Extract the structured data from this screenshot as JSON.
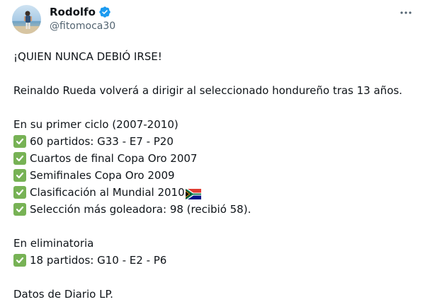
{
  "tweet": {
    "author_name": "Rodolfo",
    "author_handle": "@fitomoca30",
    "avatar_icon": "profile-photo-beach",
    "verified_icon": "verified-badge-icon",
    "more_icon": "more-options-icon",
    "lines": {
      "l1": "¡QUIEN NUNCA DEBIÓ IRSE!",
      "l2": "Reinaldo Rueda volverá a dirigir al seleccionado hondureño tras 13 años.",
      "l3": "En su primer ciclo (2007-2010)",
      "l4": "60 partidos: G33 - E7 - P20",
      "l5": "Cuartos de final Copa Oro 2007",
      "l6": "Semifinales Copa Oro 2009",
      "l7": "Clasificación al Mundial 2010",
      "l8": "Selección más goleadora: 98 (recibió 58).",
      "l9": "En eliminatoria",
      "l10": "18 partidos: G10 - E2 - P6",
      "l11": "Datos de Diario LP."
    },
    "check_icon": "check-mark-button-emoji",
    "flag_icon": "south-africa-flag-emoji"
  },
  "colors": {
    "text": "#0f1419",
    "secondary": "#536471",
    "verified": "#1d9bf0",
    "check": "#77b255"
  }
}
